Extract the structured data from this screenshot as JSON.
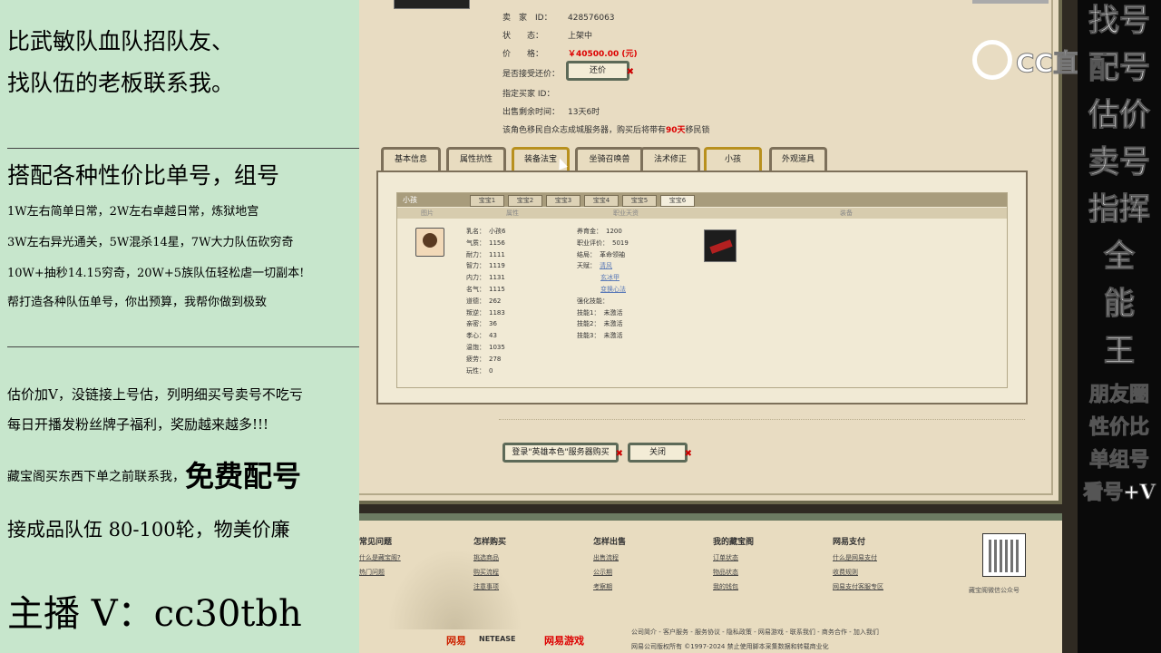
{
  "left_overlay": {
    "line1": "比武敏队血队招队友、",
    "line2": "找队伍的老板联系我。",
    "line3": "搭配各种性价比单号，组号",
    "line4": "1W左右简单日常，2W左右卓越日常，炼狱地宫",
    "line5": "3W左右异光通关，5W混杀14星，7W大力队伍砍穷奇",
    "line6": "10W+抽秒14.15穷奇，20W+5族队伍轻松虐一切副本!",
    "line7": "帮打造各种队伍单号，你出预算，我帮你做到极致",
    "line8": "估价加V，没链接上号估，列明细买号卖号不吃亏",
    "line9": "每日开播发粉丝牌子福利，奖励越来越多!!!",
    "line10": "藏宝阁买东西下单之前联系我，",
    "line10_big": "免费配号",
    "line11": "接成品队伍 80-100轮，物美价廉",
    "line12": "主播 V：cc30tbh"
  },
  "right_overlay": {
    "col_big": [
      "找号",
      "配号",
      "估价",
      "卖号",
      "指挥",
      "全",
      "能",
      "王"
    ],
    "col_small": [
      "朋友圈",
      "性价比",
      "单组号",
      "看号+V"
    ]
  },
  "watermark": {
    "text": "CC直播"
  },
  "listing": {
    "seller_label": "卖　家　ID：",
    "seller_id": "428576063",
    "status_label": "状　　态：",
    "status_value": "上架中",
    "price_label": "价　　格：",
    "price_value": "￥40500.00 (元)",
    "accept_offer_label": "是否接受还价：",
    "offer_button": "还价",
    "buyer_id_label": "指定买家 ID：",
    "remaining_label": "出售剩余时间：",
    "remaining_value": "13天6时",
    "migrate_note_pre": "该角色移民自众志成城服务器，购买后将带有",
    "migrate_days": "90天",
    "migrate_note_post": "移民锁"
  },
  "tabs": [
    "基本信息",
    "属性抗性",
    "装备法宝",
    "坐骑召唤兽",
    "法术修正",
    "小孩",
    "外观道具"
  ],
  "child_panel": {
    "header": "小孩",
    "sub_tabs": [
      "宝宝1",
      "宝宝2",
      "宝宝3",
      "宝宝4",
      "宝宝5",
      "宝宝6"
    ],
    "columns": [
      "图片",
      "属性",
      "职业天资",
      "装备"
    ],
    "stats_left": [
      {
        "k": "乳名：",
        "v": "小孩6"
      },
      {
        "k": "气质：",
        "v": "1156"
      },
      {
        "k": "耐力：",
        "v": "1111"
      },
      {
        "k": "智力：",
        "v": "1119"
      },
      {
        "k": "内力：",
        "v": "1131"
      },
      {
        "k": "名气：",
        "v": "1115"
      },
      {
        "k": "道德：",
        "v": "262"
      },
      {
        "k": "叛逆：",
        "v": "1183"
      },
      {
        "k": "亲密：",
        "v": "36"
      },
      {
        "k": "孝心：",
        "v": "43"
      },
      {
        "k": "温饱：",
        "v": "1035"
      },
      {
        "k": "疲劳：",
        "v": "278"
      },
      {
        "k": "玩性：",
        "v": "0"
      }
    ],
    "stats_right": [
      {
        "k": "养育金：",
        "v": "1200"
      },
      {
        "k": "职业评价：",
        "v": "5019"
      },
      {
        "k": "结局：",
        "v": "革命领袖"
      },
      {
        "k": "天赋：",
        "v": "清风"
      }
    ],
    "talent_links": [
      "玄冰甲",
      "变换心法"
    ],
    "skills_title": "强化技能：",
    "skills": [
      {
        "k": "技能1：",
        "v": "未激活"
      },
      {
        "k": "技能2：",
        "v": "未激活"
      },
      {
        "k": "技能3：",
        "v": "未激活"
      }
    ]
  },
  "bottom_buttons": {
    "login": "登录\"英雄本色\"服务器购买",
    "close": "关闭"
  },
  "footer": {
    "cols": [
      {
        "head": "常见问题",
        "links": [
          "什么是藏宝阁?",
          "热门问题"
        ]
      },
      {
        "head": "怎样购买",
        "links": [
          "挑选商品",
          "购买流程",
          "注意事项"
        ]
      },
      {
        "head": "怎样出售",
        "links": [
          "出售流程",
          "公示期",
          "考察期"
        ]
      },
      {
        "head": "我的藏宝阁",
        "links": [
          "订单状态",
          "物品状态",
          "我的钱包"
        ]
      },
      {
        "head": "网易支付",
        "links": [
          "什么是网易支付",
          "收费规则",
          "网易支付客服专区"
        ]
      }
    ],
    "qr_label": "藏宝阁微信公众号",
    "nav": "公司简介 - 客户服务 - 服务协议 - 隐私政策 - 网易游戏 - 联系我们 - 商务合作 - 加入我们",
    "copyright": "网易公司版权所有 ©1997-2024 禁止使用脚本采集数据和转载商业化",
    "logo_netease_cn": "网易",
    "logo_netease_en": "NETEASE",
    "logo_games": "网易游戏"
  },
  "colors": {
    "left_bg": "#c7e6cc",
    "panel_bg": "#e8dcc2",
    "accent_red": "#dd0000"
  }
}
